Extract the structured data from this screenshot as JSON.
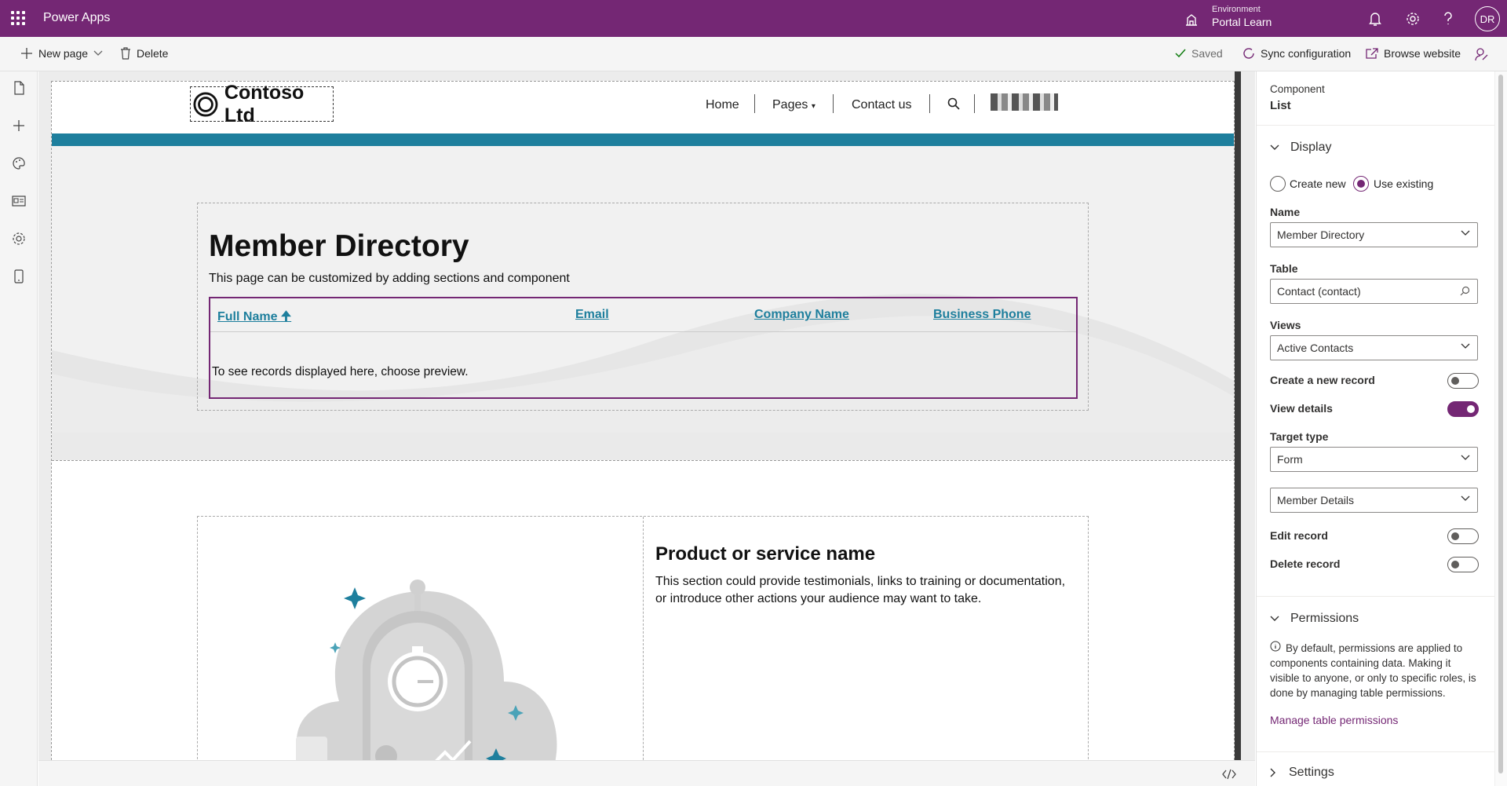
{
  "topbar": {
    "app_name": "Power Apps",
    "env_label": "Environment",
    "env_name": "Portal Learn",
    "avatar": "DR"
  },
  "commandbar": {
    "new_page": "New page",
    "delete": "Delete",
    "saved": "Saved",
    "sync": "Sync configuration",
    "browse": "Browse website"
  },
  "rail": {
    "icons": [
      "pages-icon",
      "add-icon",
      "styling-icon",
      "templates-icon",
      "settings-icon",
      "mobile-icon"
    ]
  },
  "site": {
    "brand": "Contoso Ltd",
    "nav": {
      "home": "Home",
      "pages": "Pages",
      "contact": "Contact us"
    },
    "directory": {
      "title": "Member Directory",
      "subtitle": "This page can be customized by adding sections and component",
      "columns": [
        "Full Name",
        "Email",
        "Company Name",
        "Business Phone"
      ],
      "empty_message": "To see records displayed here, choose preview."
    },
    "product": {
      "title": "Product or service name",
      "text": "This section could provide testimonials, links to training or documentation, or introduce other actions your audience may want to take."
    }
  },
  "panel": {
    "component_label": "Component",
    "component_name": "List",
    "display": {
      "heading": "Display",
      "radio_create": "Create new",
      "radio_existing": "Use existing",
      "selected": "Use existing",
      "name_label": "Name",
      "name_value": "Member Directory",
      "table_label": "Table",
      "table_value": "Contact (contact)",
      "views_label": "Views",
      "views_value": "Active Contacts",
      "create_record_label": "Create a new record",
      "create_record": false,
      "view_details_label": "View details",
      "view_details": true,
      "target_type_label": "Target type",
      "target_type_value": "Form",
      "form_value": "Member Details",
      "edit_record_label": "Edit record",
      "edit_record": false,
      "delete_record_label": "Delete record",
      "delete_record": false
    },
    "permissions": {
      "heading": "Permissions",
      "info": "By default, permissions are applied to components containing data. Making it visible to anyone, or only to specific roles, is done by managing table permissions.",
      "link": "Manage table permissions"
    },
    "settings": {
      "heading": "Settings"
    }
  },
  "colors": {
    "brand": "#742774",
    "accent": "#1e7f9d"
  }
}
